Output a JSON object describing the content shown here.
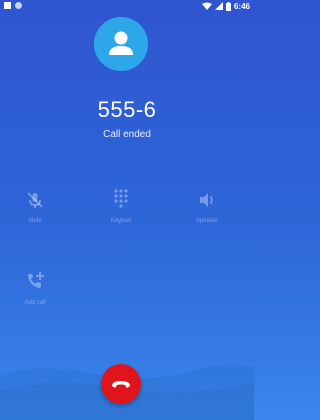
{
  "status_bar": {
    "time": "6:46"
  },
  "call": {
    "number": "555-6",
    "state": "Call ended"
  },
  "controls": {
    "mute": {
      "label": "Mute",
      "icon": "mic-off-icon"
    },
    "keypad": {
      "label": "Keypad",
      "icon": "dialpad-icon"
    },
    "speaker": {
      "label": "Speaker",
      "icon": "volume-icon"
    },
    "add_call": {
      "label": "Add call",
      "icon": "add-call-icon"
    }
  },
  "end_call": {
    "icon": "end-call-icon",
    "color": "#e0141b"
  },
  "colors": {
    "background_top": "#2f55cf",
    "background_bottom": "#3a86ec",
    "avatar": "#2ea7ea"
  }
}
